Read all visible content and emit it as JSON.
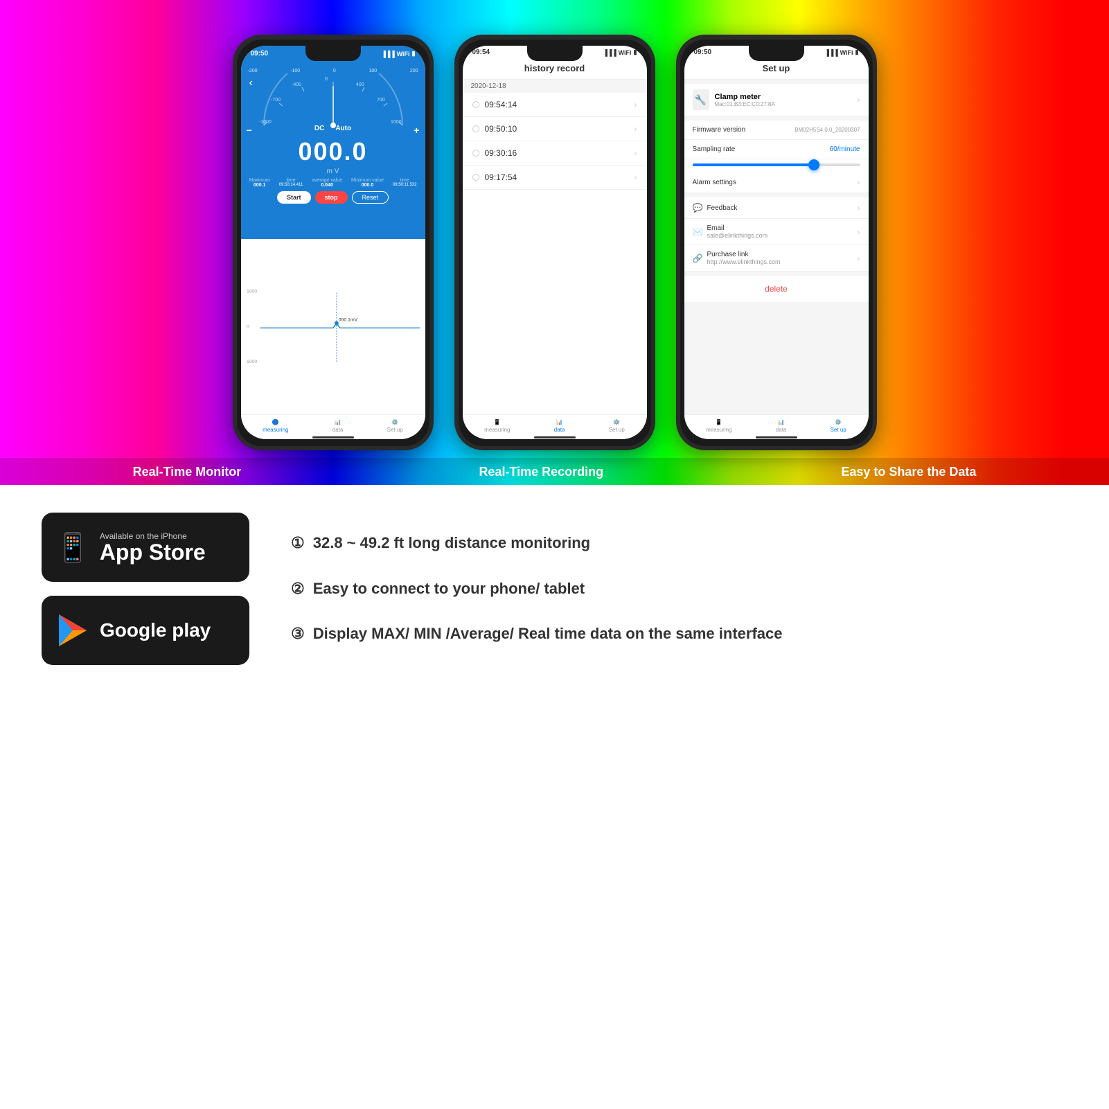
{
  "top_section": {
    "background": "rainbow gradient"
  },
  "phones": [
    {
      "id": "phone1",
      "label": "Real-Time Monitor",
      "status_time": "09:50",
      "screen": "measuring",
      "dc": "DC",
      "auto": "Auto",
      "main_value": "000.0",
      "unit": "m V",
      "stats": {
        "maximum_label": "Maximum",
        "maximum_value": "000.1",
        "time1_label": "time",
        "time1_value": "09:50:14.411",
        "avg_label": "average value",
        "avg_value": "0.040",
        "min_label": "Minimum value",
        "min_value": "000.0",
        "time2_label": "time",
        "time2_value": "09:50:11.532"
      },
      "buttons": [
        "Start",
        "stop",
        "Reset"
      ],
      "chart_value": "000.1mV",
      "nav": [
        "measuring",
        "data",
        "Set up"
      ]
    },
    {
      "id": "phone2",
      "label": "Real-Time Recording",
      "status_time": "09:54",
      "screen": "history",
      "title": "history record",
      "date": "2020-12-18",
      "history_items": [
        "09:54:14",
        "09:50:10",
        "09:30:16",
        "09:17:54"
      ],
      "nav": [
        "measuring",
        "data",
        "Set up"
      ]
    },
    {
      "id": "phone3",
      "label": "Easy to Share the Data",
      "status_time": "09:50",
      "screen": "setup",
      "title": "Set up",
      "device_name": "Clamp meter",
      "device_mac": "Mac:01:B3:EC:C0:27:8A",
      "firmware_label": "Firmware version",
      "firmware_value": "BM02H5S4.0.0_20200307",
      "sampling_label": "Sampling rate",
      "sampling_value": "60/minute",
      "alarm_label": "Alarm settings",
      "feedback_label": "Feedback",
      "email_label": "Email",
      "email_value": "sale@elinkthings.com",
      "purchase_label": "Purchase link",
      "purchase_value": "http://www.elinkthings.com",
      "delete_label": "delete",
      "nav": [
        "measuring",
        "data",
        "Set up"
      ]
    }
  ],
  "features": [
    {
      "number": "①",
      "text": "32.8 ~ 49.2 ft long distance monitoring"
    },
    {
      "number": "②",
      "text": "Easy to connect to your phone/ tablet"
    },
    {
      "number": "③",
      "text": "Display MAX/ MIN /Average/ Real time data on the same interface"
    }
  ],
  "app_store": {
    "subtitle": "Available on the iPhone",
    "title": "App Store",
    "icon": "📱"
  },
  "google_play": {
    "title": "Google play",
    "icon": "▶"
  }
}
